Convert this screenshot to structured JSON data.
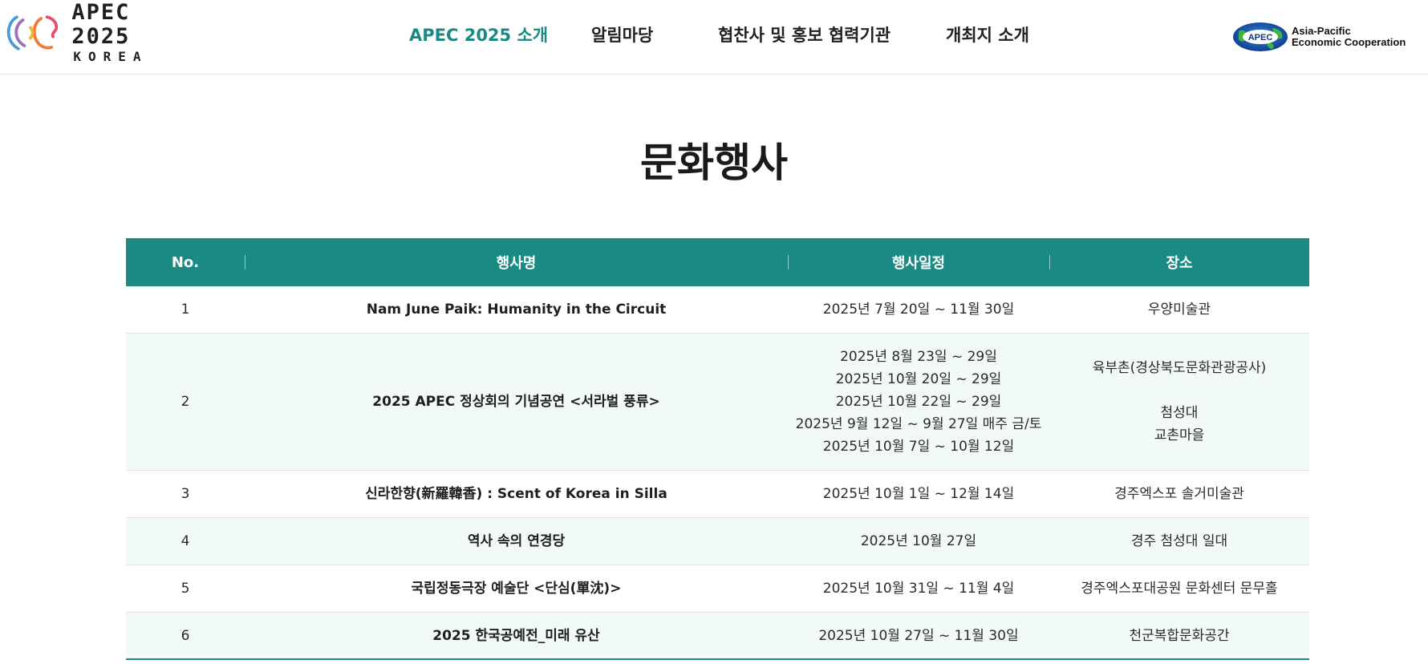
{
  "header": {
    "logo": {
      "title": "APEC 2025",
      "subtitle": "KOREA"
    },
    "nav": [
      {
        "label": "APEC 2025 소개",
        "active": true
      },
      {
        "label": "알림마당",
        "active": false
      },
      {
        "label": "협찬사 및 홍보 협력기관",
        "active": false
      },
      {
        "label": "개최지 소개",
        "active": false
      }
    ],
    "apec_logo": {
      "badge": "APEC",
      "line1": "Asia-Pacific",
      "line2": "Economic Cooperation"
    }
  },
  "page": {
    "title": "문화행사"
  },
  "table": {
    "headers": {
      "no": "No.",
      "name": "행사명",
      "date": "행사일정",
      "place": "장소"
    },
    "rows": [
      {
        "no": "1",
        "name": "Nam June Paik: Humanity in the Circuit",
        "dates": [
          "2025년 7월 20일 ~ 11월 30일"
        ],
        "places": [
          "우양미술관"
        ]
      },
      {
        "no": "2",
        "name": "2025 APEC 정상회의 기념공연 <서라벌 풍류>",
        "dates": [
          "2025년 8월 23일 ~ 29일",
          "2025년 10월 20일 ~ 29일",
          "2025년 10월 22일 ~ 29일",
          "2025년 9월 12일 ~ 9월 27일 매주 금/토",
          "2025년 10월 7일 ~ 10월 12일"
        ],
        "places": [
          "육부촌(경상북도문화관광공사)",
          "첨성대",
          "교촌마을"
        ]
      },
      {
        "no": "3",
        "name": "신라한향(新羅韓香) : Scent of Korea in Silla",
        "dates": [
          "2025년 10월 1일 ~ 12월 14일"
        ],
        "places": [
          "경주엑스포 솔거미술관"
        ]
      },
      {
        "no": "4",
        "name": "역사 속의 연경당",
        "dates": [
          "2025년 10월 27일"
        ],
        "places": [
          "경주 첨성대 일대"
        ]
      },
      {
        "no": "5",
        "name": "국립정동극장 예술단 <단심(單沈)>",
        "dates": [
          "2025년 10월 31일 ~ 11월 4일"
        ],
        "places": [
          "경주엑스포대공원 문화센터 문무홀"
        ]
      },
      {
        "no": "6",
        "name": "2025 한국공예전_미래 유산",
        "dates": [
          "2025년 10월 27일 ~ 11월 30일"
        ],
        "places": [
          "천군복합문화공간"
        ]
      }
    ]
  },
  "colors": {
    "accent": "#1b8a84",
    "row_alt": "#f1f9f9",
    "active_nav": "#1b8a84"
  }
}
